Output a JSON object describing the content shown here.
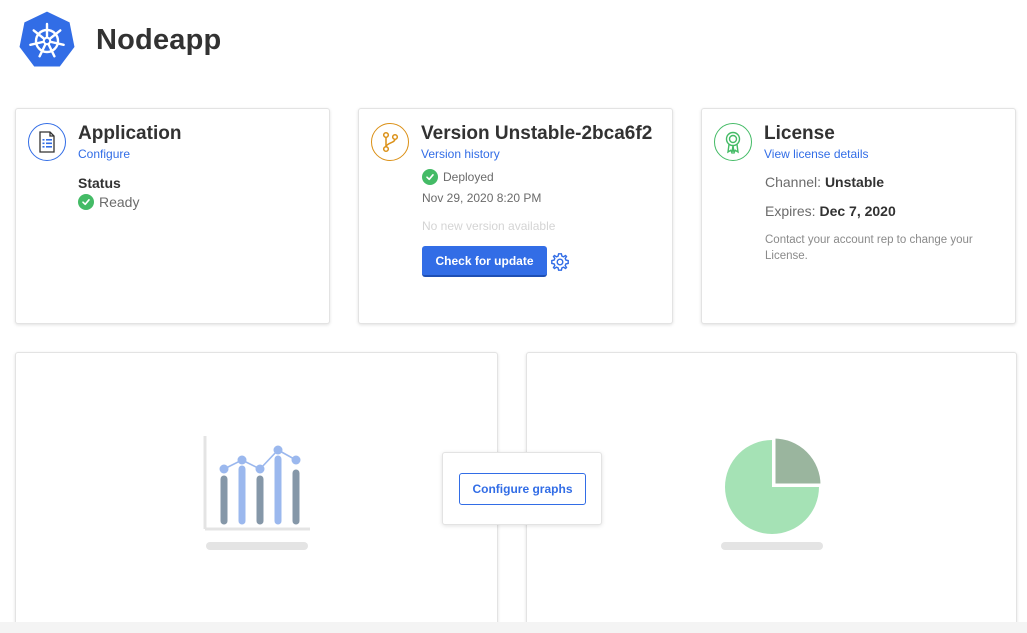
{
  "app": {
    "title": "Nodeapp"
  },
  "application_card": {
    "title": "Application",
    "link": "Configure",
    "status_label": "Status",
    "status_value": "Ready"
  },
  "version_card": {
    "title": "Version Unstable-2bca6f2",
    "link": "Version history",
    "deploy_status": "Deployed",
    "deploy_date": "Nov 29, 2020 8:20 PM",
    "update_message": "No new version available",
    "check_button": "Check for update"
  },
  "license_card": {
    "title": "License",
    "link": "View license details",
    "channel_label": "Channel:",
    "channel_value": "Unstable",
    "expires_label": "Expires:",
    "expires_value": "Dec 7, 2020",
    "note": "Contact your account rep to change your License."
  },
  "graphs": {
    "configure_button": "Configure graphs"
  },
  "colors": {
    "brand": "#326de6",
    "success": "#44bb66",
    "warning": "#db9016",
    "text": "#323232",
    "muted": "#6b6b6b"
  },
  "icons": {
    "logo": "kubernetes-helm-icon",
    "application": "document-list-icon",
    "version": "git-branch-icon",
    "license": "award-ribbon-icon",
    "status": "check-circle-icon",
    "settings": "gear-icon"
  }
}
